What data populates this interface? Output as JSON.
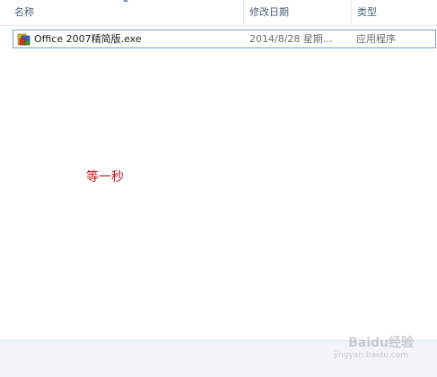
{
  "columns": {
    "name": "名称",
    "date_modified": "修改日期",
    "type": "类型"
  },
  "files": [
    {
      "name": "Office 2007精简版.exe",
      "date_modified": "2014/8/28 星期...",
      "type": "应用程序",
      "icon": "office-setup-icon"
    }
  ],
  "annotation": "等一秒",
  "watermark": {
    "text": "Baidu经验",
    "sub": "jingyan.baidu.com"
  },
  "colors": {
    "annotation": "#c0141b",
    "selection_border": "#7da2ce",
    "header_text": "#4c607a"
  }
}
